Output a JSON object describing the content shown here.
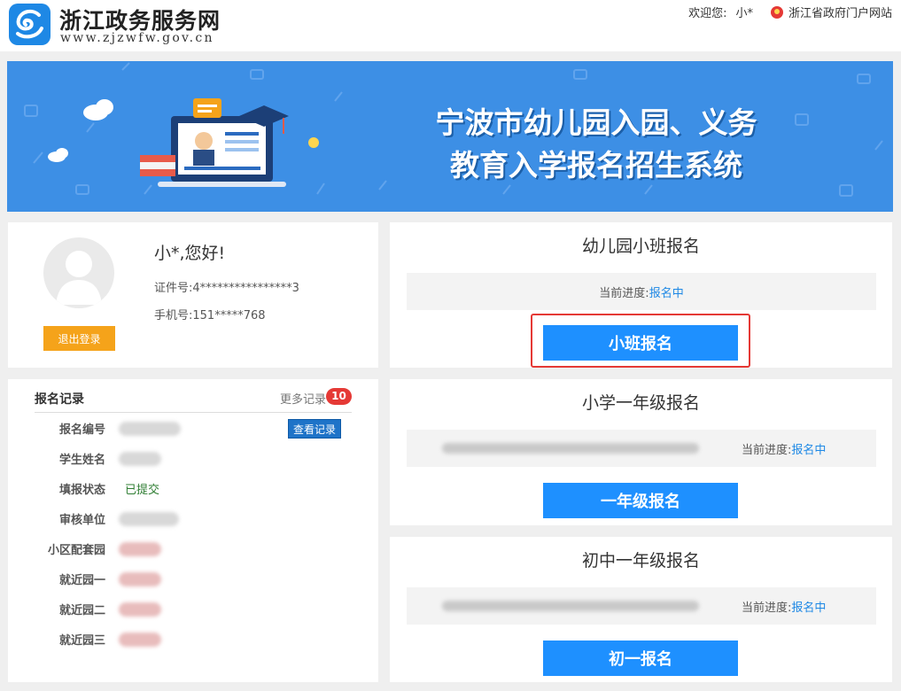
{
  "header": {
    "title": "浙江政务服务网",
    "subtitle": "www.zjzwfw.gov.cn",
    "welcome_label": "欢迎您:",
    "username": "小*",
    "portal_link": "浙江省政府门户网站"
  },
  "banner": {
    "title_line1": "宁波市幼儿园入园、义务",
    "title_line2": "教育入学报名招生系统"
  },
  "profile": {
    "greeting": "小*,您好!",
    "id_line": "证件号:4****************3",
    "phone_line": "手机号:151*****768",
    "logout_label": "退出登录"
  },
  "records": {
    "title": "报名记录",
    "more_label": "更多记录",
    "count": "10",
    "view_button": "查看记录",
    "rows": [
      {
        "label": "报名编号",
        "value": ""
      },
      {
        "label": "学生姓名",
        "value": ""
      },
      {
        "label": "填报状态",
        "value": "已提交"
      },
      {
        "label": "审核单位",
        "value": ""
      },
      {
        "label": "小区配套园",
        "value": ""
      },
      {
        "label": "就近园一",
        "value": ""
      },
      {
        "label": "就近园二",
        "value": ""
      },
      {
        "label": "就近园三",
        "value": ""
      }
    ]
  },
  "cards": [
    {
      "title": "幼儿园小班报名",
      "progress_label": "当前进度:",
      "status": "报名中",
      "button": "小班报名"
    },
    {
      "title": "小学一年级报名",
      "progress_label": "当前进度:",
      "status": "报名中",
      "button": "一年级报名"
    },
    {
      "title": "初中一年级报名",
      "progress_label": "当前进度:",
      "status": "报名中",
      "button": "初一报名"
    }
  ],
  "colors": {
    "brand": "#1e88e5",
    "banner": "#3d8fe5",
    "button": "#1e90ff",
    "logout": "#f5a31a",
    "badge": "#e53935",
    "highlight": "#e53935"
  }
}
